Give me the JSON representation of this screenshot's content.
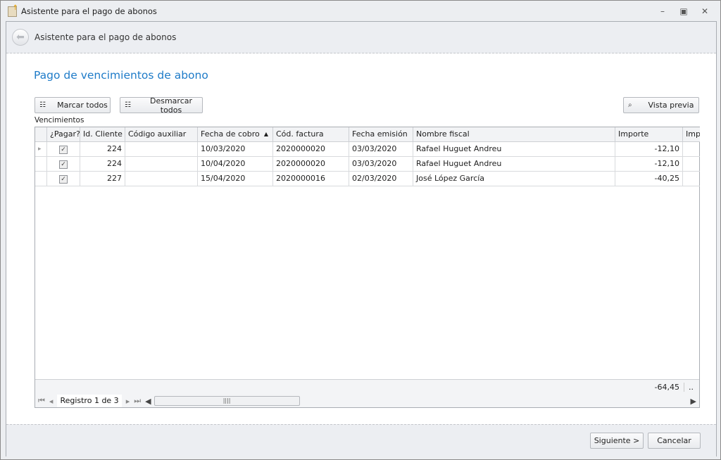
{
  "window": {
    "title": "Asistente para el pago de abonos"
  },
  "header": {
    "title": "Asistente para el pago de abonos"
  },
  "page_title": "Pago de vencimientos de abono",
  "toolbar": {
    "mark_all": "Marcar todos",
    "unmark_all": "Desmarcar todos",
    "preview": "Vista previa"
  },
  "grid": {
    "label": "Vencimientos",
    "columns": [
      "¿Pagar?",
      "Id. Cliente",
      "Código auxiliar",
      "Fecha de cobro",
      "Cód. factura",
      "Fecha emisión",
      "Nombre fiscal",
      "Importe",
      "Imp"
    ],
    "rows": [
      {
        "pay": true,
        "client": "224",
        "aux": "",
        "due": "10/03/2020",
        "invoice": "2020000020",
        "issued": "03/03/2020",
        "name": "Rafael Huguet Andreu",
        "amount": "-12,10"
      },
      {
        "pay": true,
        "client": "224",
        "aux": "",
        "due": "10/04/2020",
        "invoice": "2020000020",
        "issued": "03/03/2020",
        "name": "Rafael Huguet Andreu",
        "amount": "-12,10"
      },
      {
        "pay": true,
        "client": "227",
        "aux": "",
        "due": "15/04/2020",
        "invoice": "2020000016",
        "issued": "02/03/2020",
        "name": "José López García",
        "amount": "-40,25"
      }
    ],
    "total": "-64,45",
    "total_more": "..",
    "record": "Registro 1 de 3"
  },
  "footer": {
    "next": "Siguiente >",
    "cancel": "Cancelar"
  }
}
